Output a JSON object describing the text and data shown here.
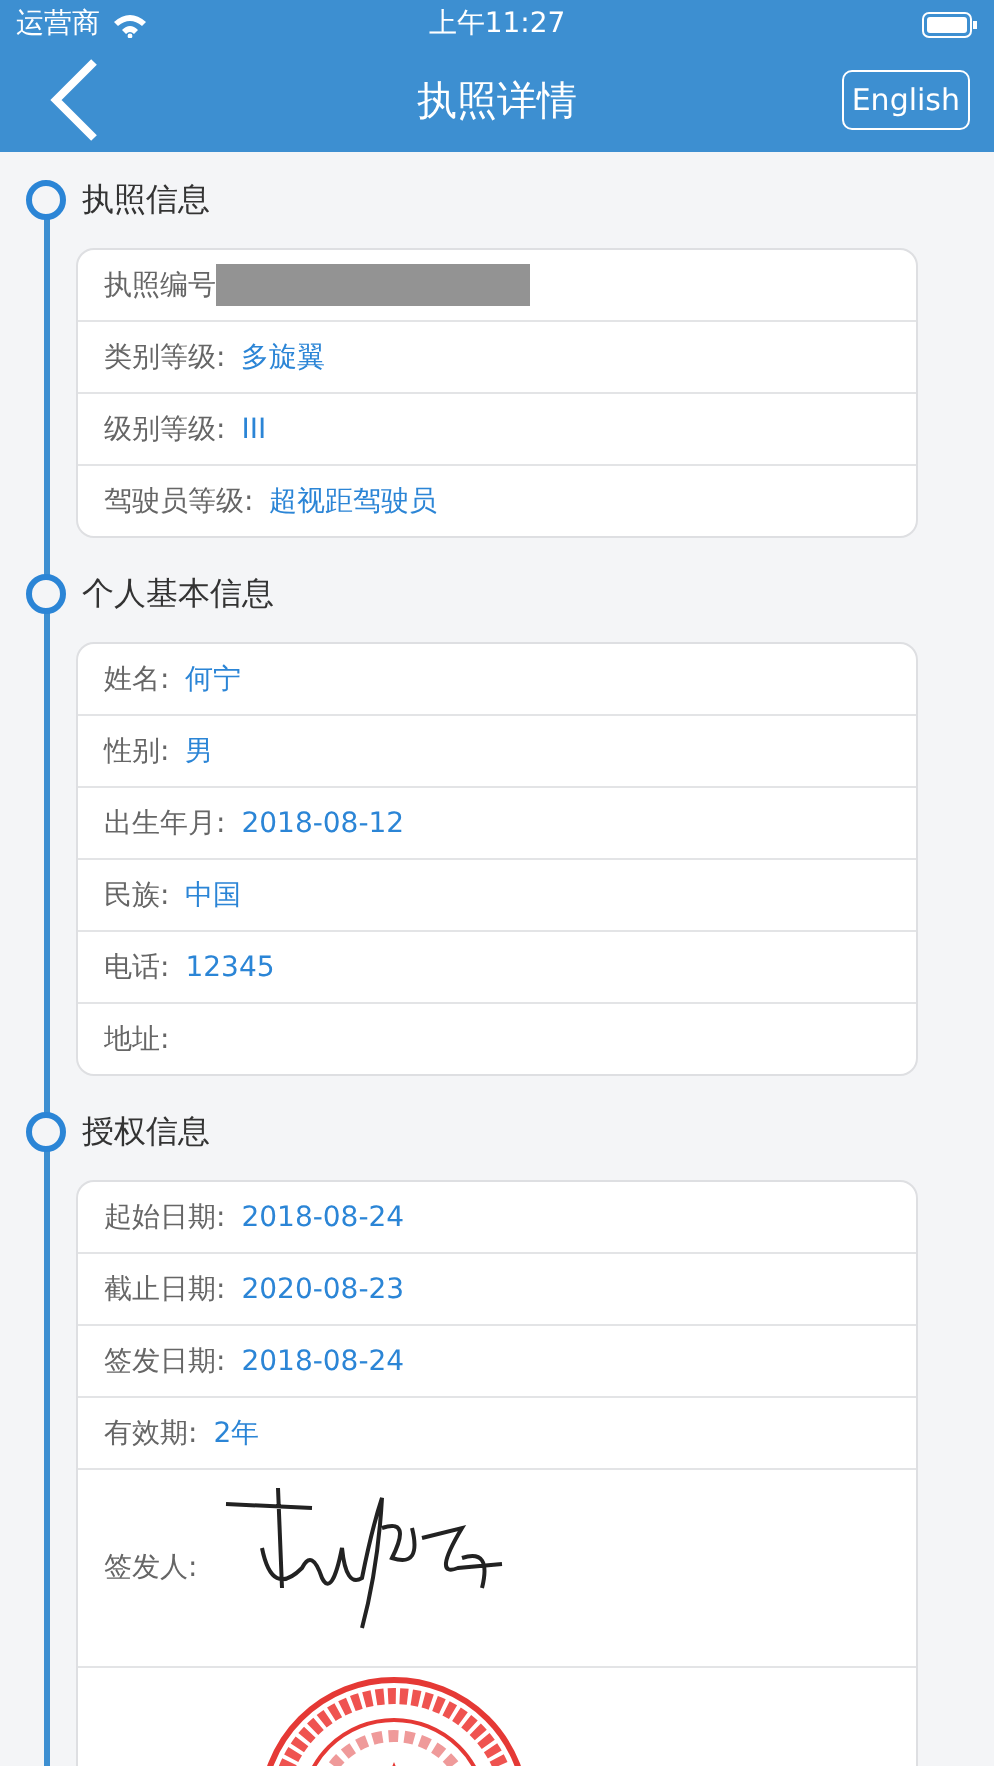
{
  "status_bar": {
    "carrier": "运营商",
    "time": "上午11:27"
  },
  "nav": {
    "title": "执照详情",
    "language_button": "English"
  },
  "sections": [
    {
      "title": "执照信息",
      "rows": [
        {
          "kind": "redacted",
          "label": "执照编号"
        },
        {
          "kind": "text",
          "label": "类别等级:",
          "value": "多旋翼"
        },
        {
          "kind": "text",
          "label": "级别等级:",
          "value": "III"
        },
        {
          "kind": "text",
          "label": "驾驶员等级:",
          "value": "超视距驾驶员"
        }
      ]
    },
    {
      "title": "个人基本信息",
      "rows": [
        {
          "kind": "text",
          "label": "姓名:",
          "value": "何宁"
        },
        {
          "kind": "text",
          "label": "性别:",
          "value": "男"
        },
        {
          "kind": "text",
          "label": "出生年月:",
          "value": "2018-08-12"
        },
        {
          "kind": "text",
          "label": "民族:",
          "value": "中国"
        },
        {
          "kind": "text",
          "label": "电话:",
          "value": "12345"
        },
        {
          "kind": "text",
          "label": "地址:"
        }
      ]
    },
    {
      "title": "授权信息",
      "rows": [
        {
          "kind": "text",
          "label": "起始日期:",
          "value": "2018-08-24"
        },
        {
          "kind": "text",
          "label": "截止日期:",
          "value": "2020-08-23"
        },
        {
          "kind": "text",
          "label": "签发日期:",
          "value": "2018-08-24"
        },
        {
          "kind": "text",
          "label": "有效期:",
          "value": "2年"
        },
        {
          "kind": "signature",
          "label": "签发人:"
        },
        {
          "kind": "stamp"
        }
      ]
    }
  ]
}
